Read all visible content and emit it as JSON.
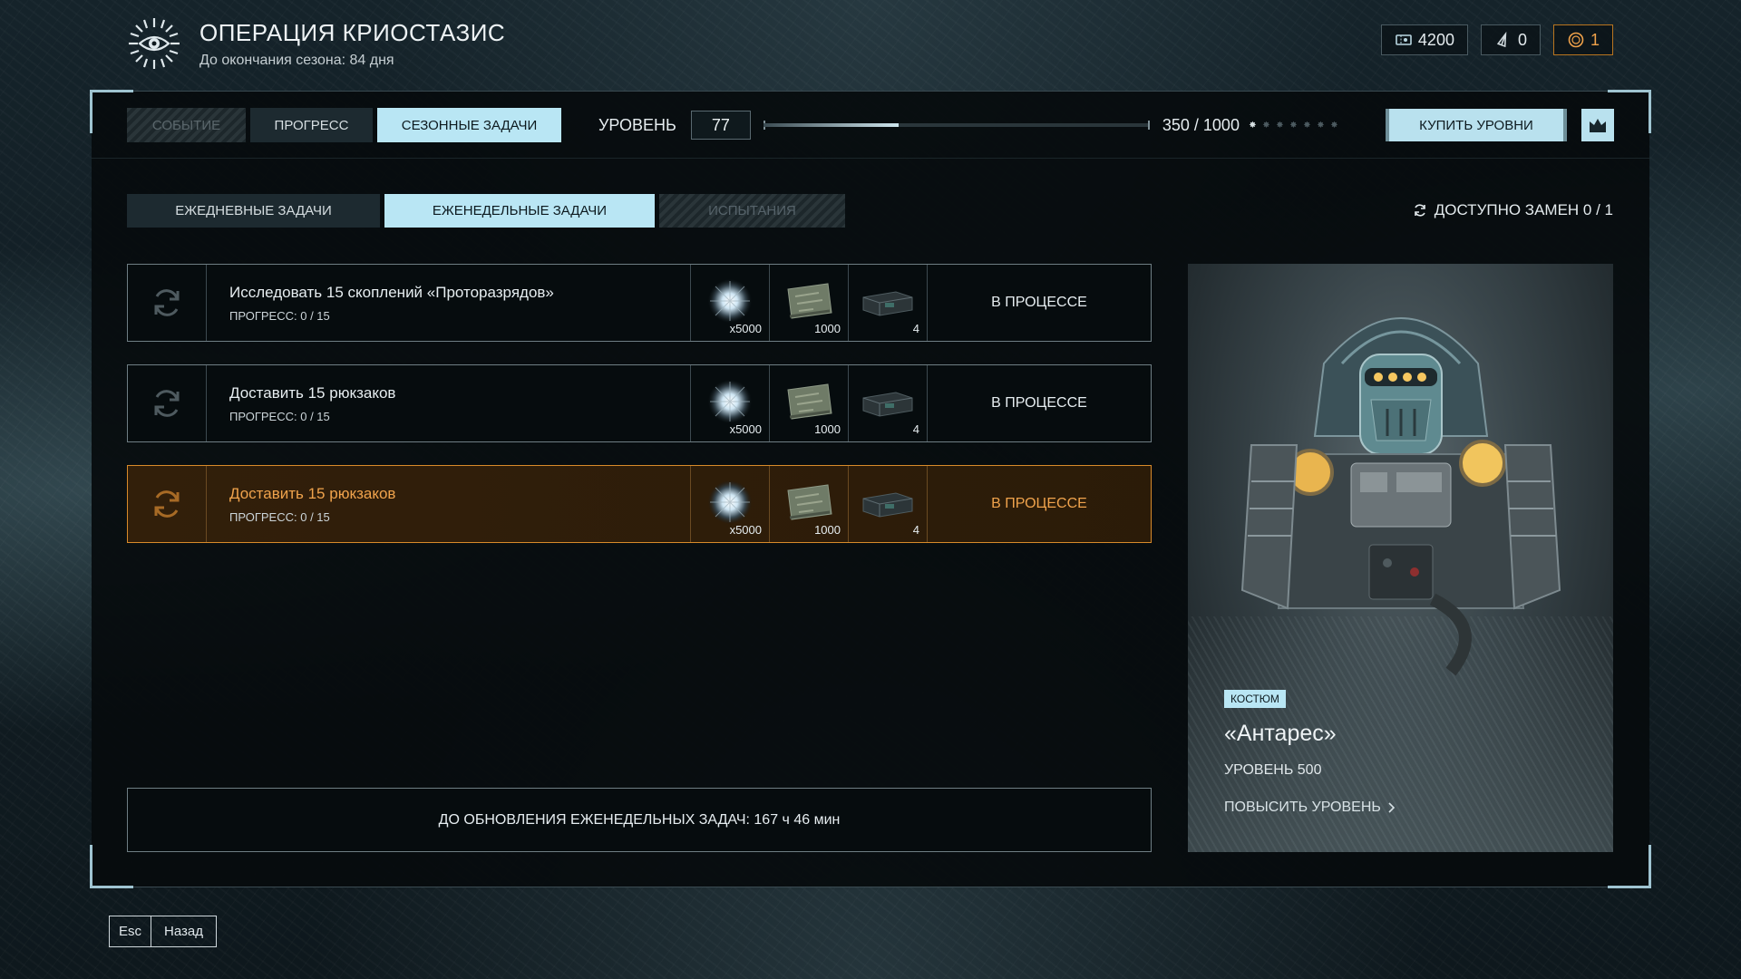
{
  "header": {
    "title": "ОПЕРАЦИЯ КРИОСТАЗИС",
    "subtitle": "До окончания сезона: 84 дня",
    "logo_icon": "eye-sun-icon"
  },
  "currencies": [
    {
      "icon": "ticket-icon",
      "value": "4200"
    },
    {
      "icon": "crystal-icon",
      "value": "0"
    },
    {
      "icon": "coin-icon",
      "value": "1"
    }
  ],
  "tabs": [
    {
      "label": "СОБЫТИЕ",
      "state": "disabled"
    },
    {
      "label": "ПРОГРЕСС",
      "state": "normal"
    },
    {
      "label": "СЕЗОННЫЕ ЗАДАЧИ",
      "state": "active"
    }
  ],
  "level": {
    "label": "УРОВЕНЬ",
    "value": "77",
    "xp_text": "350 / 1000",
    "xp_fraction": 0.35,
    "pips_total": 7,
    "pips_filled": 1
  },
  "buy_levels_label": "КУПИТЬ УРОВНИ",
  "subtabs": [
    {
      "label": "ЕЖЕДНЕВНЫЕ ЗАДАЧИ",
      "state": "normal"
    },
    {
      "label": "ЕЖЕНЕДЕЛЬНЫЕ ЗАДАЧИ",
      "state": "active"
    },
    {
      "label": "ИСПЫТАНИЯ",
      "state": "disabled"
    }
  ],
  "swaps_label": "ДОСТУПНО ЗАМЕН 0 / 1",
  "tasks": [
    {
      "name": "Исследовать 15 скоплений «Проторазрядов»",
      "progress": "ПРОГРЕСС: 0 / 15",
      "rewards": [
        {
          "icon": "energy-orb-icon",
          "qty": "x5000"
        },
        {
          "icon": "map-icon",
          "qty": "1000"
        },
        {
          "icon": "crate-icon",
          "qty": "4"
        }
      ],
      "status": "В ПРОЦЕССЕ",
      "highlighted": false
    },
    {
      "name": "Доставить 15 рюкзаков",
      "progress": "ПРОГРЕСС: 0 / 15",
      "rewards": [
        {
          "icon": "energy-orb-icon",
          "qty": "x5000"
        },
        {
          "icon": "map-icon",
          "qty": "1000"
        },
        {
          "icon": "crate-icon",
          "qty": "4"
        }
      ],
      "status": "В ПРОЦЕССЕ",
      "highlighted": false
    },
    {
      "name": "Доставить 15 рюкзаков",
      "progress": "ПРОГРЕСС: 0 / 15",
      "rewards": [
        {
          "icon": "energy-orb-icon",
          "qty": "x5000"
        },
        {
          "icon": "map-icon",
          "qty": "1000"
        },
        {
          "icon": "crate-icon",
          "qty": "4"
        }
      ],
      "status": "В ПРОЦЕССЕ",
      "highlighted": true
    }
  ],
  "timer_text": "ДО ОБНОВЛЕНИЯ ЕЖЕНЕДЕЛЬНЫХ ЗАДАЧ: 167 ч 46 мин",
  "reward_card": {
    "badge": "КОСТЮМ",
    "name": "«Антарес»",
    "level": "УРОВЕНЬ 500",
    "upgrade_label": "ПОВЫСИТЬ УРОВЕНЬ"
  },
  "footer": {
    "key": "Esc",
    "action": "Назад"
  },
  "colors": {
    "accent": "#b9e6f4",
    "highlight": "#f0a34c",
    "gold_border": "#b9751f"
  }
}
